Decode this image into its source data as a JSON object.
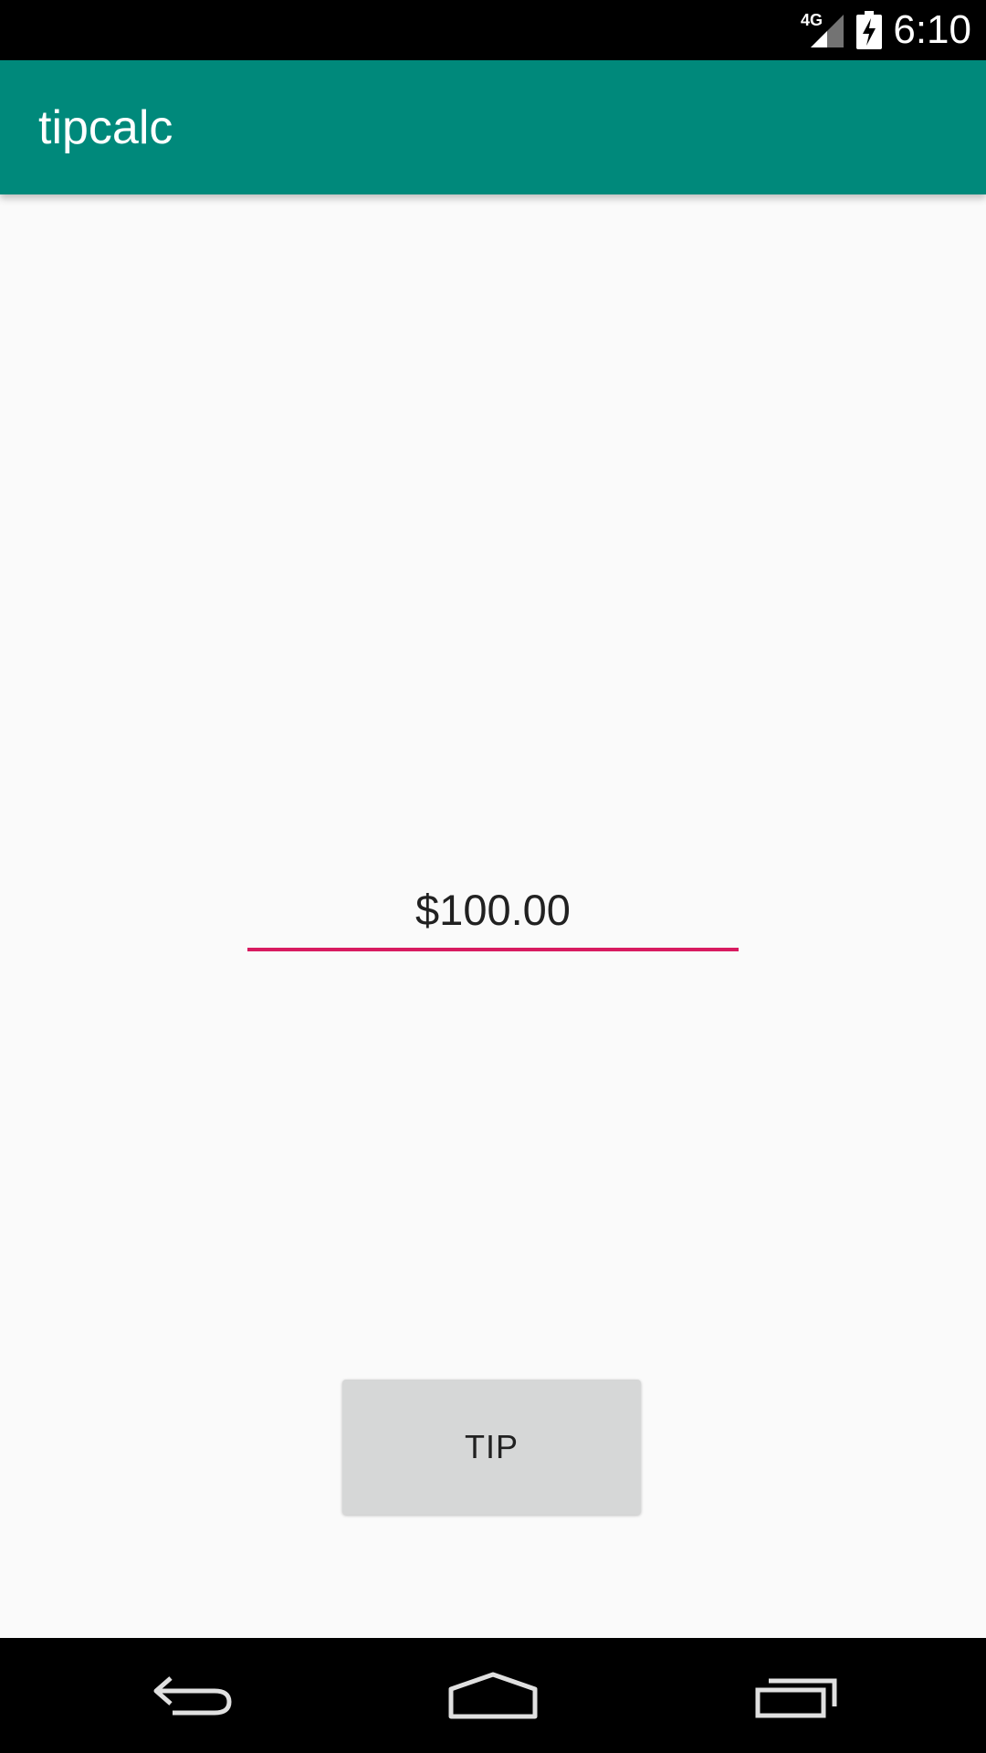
{
  "status_bar": {
    "network": "4G",
    "time": "6:10"
  },
  "app_bar": {
    "title": "tipcalc",
    "color": "#00897b"
  },
  "amount_input": {
    "value": "$100.00",
    "underline_color": "#d81b60"
  },
  "tip_button": {
    "label": "TIP"
  },
  "nav_bar": {
    "icons": [
      "back-icon",
      "home-icon",
      "recents-icon"
    ]
  }
}
